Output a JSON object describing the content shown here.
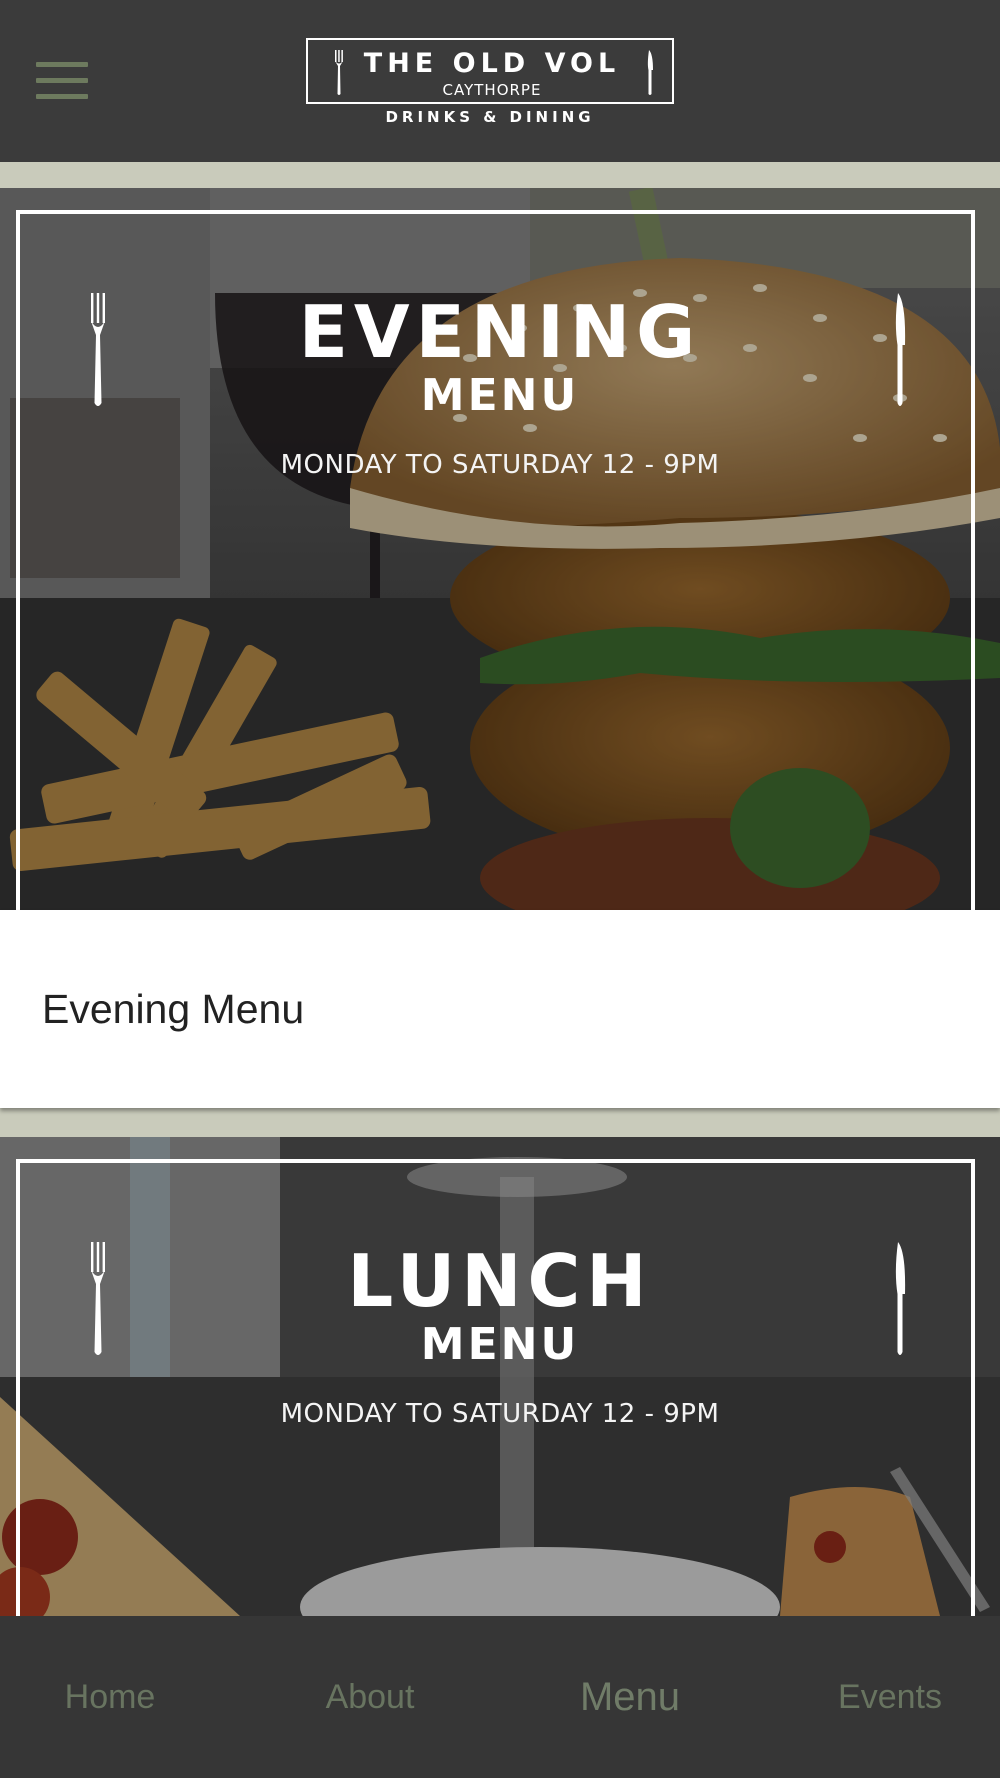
{
  "header": {
    "logo": {
      "title": "THE OLD VOL",
      "subtitle": "CAYTHORPE",
      "tagline": "DRINKS & DINING"
    }
  },
  "cards": [
    {
      "banner_title": "EVENING",
      "banner_menu": "MENU",
      "banner_hours": "MONDAY TO SATURDAY 12 - 9PM",
      "caption": "Evening Menu"
    },
    {
      "banner_title": "LUNCH",
      "banner_menu": "MENU",
      "banner_hours": "MONDAY TO SATURDAY 12 - 9PM"
    }
  ],
  "bottom_nav": {
    "items": [
      {
        "label": "Home"
      },
      {
        "label": "About"
      },
      {
        "label": "Menu",
        "active": true
      },
      {
        "label": "Events"
      }
    ]
  },
  "colors": {
    "header_bg": "#3b3b3b",
    "accent_green": "#6d7a5e",
    "page_bg": "#c9cbbb",
    "nav_bg": "#363636"
  }
}
